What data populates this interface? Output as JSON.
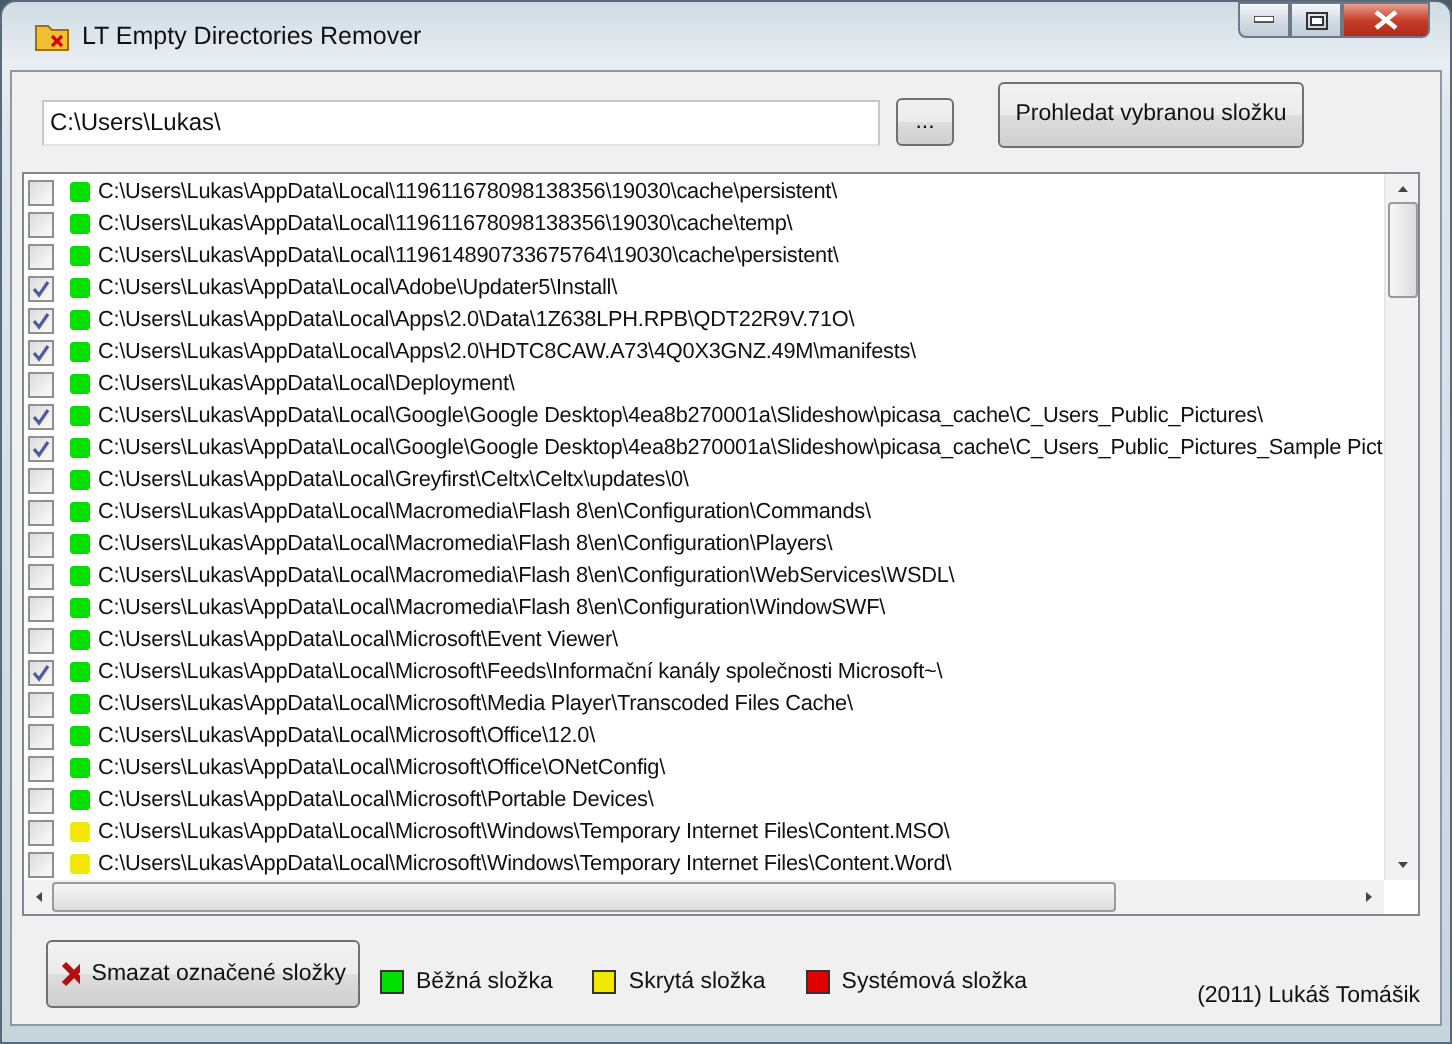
{
  "window": {
    "title": "LT Empty Directories Remover"
  },
  "toolbar": {
    "path": "C:\\Users\\Lukas\\",
    "browse_button": "...",
    "search_button": "Prohledat vybranou složku"
  },
  "folders": [
    {
      "path": "C:\\Users\\Lukas\\AppData\\Local\\119611678098138356\\19030\\cache\\persistent\\",
      "checked": false,
      "color": "#00e000"
    },
    {
      "path": "C:\\Users\\Lukas\\AppData\\Local\\119611678098138356\\19030\\cache\\temp\\",
      "checked": false,
      "color": "#00e000"
    },
    {
      "path": "C:\\Users\\Lukas\\AppData\\Local\\119614890733675764\\19030\\cache\\persistent\\",
      "checked": false,
      "color": "#00e000"
    },
    {
      "path": "C:\\Users\\Lukas\\AppData\\Local\\Adobe\\Updater5\\Install\\",
      "checked": true,
      "color": "#00e000"
    },
    {
      "path": "C:\\Users\\Lukas\\AppData\\Local\\Apps\\2.0\\Data\\1Z638LPH.RPB\\QDT22R9V.71O\\",
      "checked": true,
      "color": "#00e000"
    },
    {
      "path": "C:\\Users\\Lukas\\AppData\\Local\\Apps\\2.0\\HDTC8CAW.A73\\4Q0X3GNZ.49M\\manifests\\",
      "checked": true,
      "color": "#00e000"
    },
    {
      "path": "C:\\Users\\Lukas\\AppData\\Local\\Deployment\\",
      "checked": false,
      "color": "#00e000"
    },
    {
      "path": "C:\\Users\\Lukas\\AppData\\Local\\Google\\Google Desktop\\4ea8b270001a\\Slideshow\\picasa_cache\\C_Users_Public_Pictures\\",
      "checked": true,
      "color": "#00e000"
    },
    {
      "path": "C:\\Users\\Lukas\\AppData\\Local\\Google\\Google Desktop\\4ea8b270001a\\Slideshow\\picasa_cache\\C_Users_Public_Pictures_Sample Pict",
      "checked": true,
      "color": "#00e000"
    },
    {
      "path": "C:\\Users\\Lukas\\AppData\\Local\\Greyfirst\\Celtx\\Celtx\\updates\\0\\",
      "checked": false,
      "color": "#00e000"
    },
    {
      "path": "C:\\Users\\Lukas\\AppData\\Local\\Macromedia\\Flash 8\\en\\Configuration\\Commands\\",
      "checked": false,
      "color": "#00e000"
    },
    {
      "path": "C:\\Users\\Lukas\\AppData\\Local\\Macromedia\\Flash 8\\en\\Configuration\\Players\\",
      "checked": false,
      "color": "#00e000"
    },
    {
      "path": "C:\\Users\\Lukas\\AppData\\Local\\Macromedia\\Flash 8\\en\\Configuration\\WebServices\\WSDL\\",
      "checked": false,
      "color": "#00e000"
    },
    {
      "path": "C:\\Users\\Lukas\\AppData\\Local\\Macromedia\\Flash 8\\en\\Configuration\\WindowSWF\\",
      "checked": false,
      "color": "#00e000"
    },
    {
      "path": "C:\\Users\\Lukas\\AppData\\Local\\Microsoft\\Event Viewer\\",
      "checked": false,
      "color": "#00e000"
    },
    {
      "path": "C:\\Users\\Lukas\\AppData\\Local\\Microsoft\\Feeds\\Informační kanály společnosti Microsoft~\\",
      "checked": true,
      "color": "#00e000"
    },
    {
      "path": "C:\\Users\\Lukas\\AppData\\Local\\Microsoft\\Media Player\\Transcoded Files Cache\\",
      "checked": false,
      "color": "#00e000"
    },
    {
      "path": "C:\\Users\\Lukas\\AppData\\Local\\Microsoft\\Office\\12.0\\",
      "checked": false,
      "color": "#00e000"
    },
    {
      "path": "C:\\Users\\Lukas\\AppData\\Local\\Microsoft\\Office\\ONetConfig\\",
      "checked": false,
      "color": "#00e000"
    },
    {
      "path": "C:\\Users\\Lukas\\AppData\\Local\\Microsoft\\Portable Devices\\",
      "checked": false,
      "color": "#00e000"
    },
    {
      "path": "C:\\Users\\Lukas\\AppData\\Local\\Microsoft\\Windows\\Temporary Internet Files\\Content.MSO\\",
      "checked": false,
      "color": "#f0e800"
    },
    {
      "path": "C:\\Users\\Lukas\\AppData\\Local\\Microsoft\\Windows\\Temporary Internet Files\\Content.Word\\",
      "checked": false,
      "color": "#f0e800"
    }
  ],
  "footer": {
    "delete_button": "Smazat označené složky",
    "legend": [
      {
        "label": "Běžná složka",
        "color": "#00e000"
      },
      {
        "label": "Skrytá složka",
        "color": "#f0e800"
      },
      {
        "label": "Systémová složka",
        "color": "#e00000"
      }
    ],
    "credits": "(2011) Lukáš Tomášik"
  }
}
